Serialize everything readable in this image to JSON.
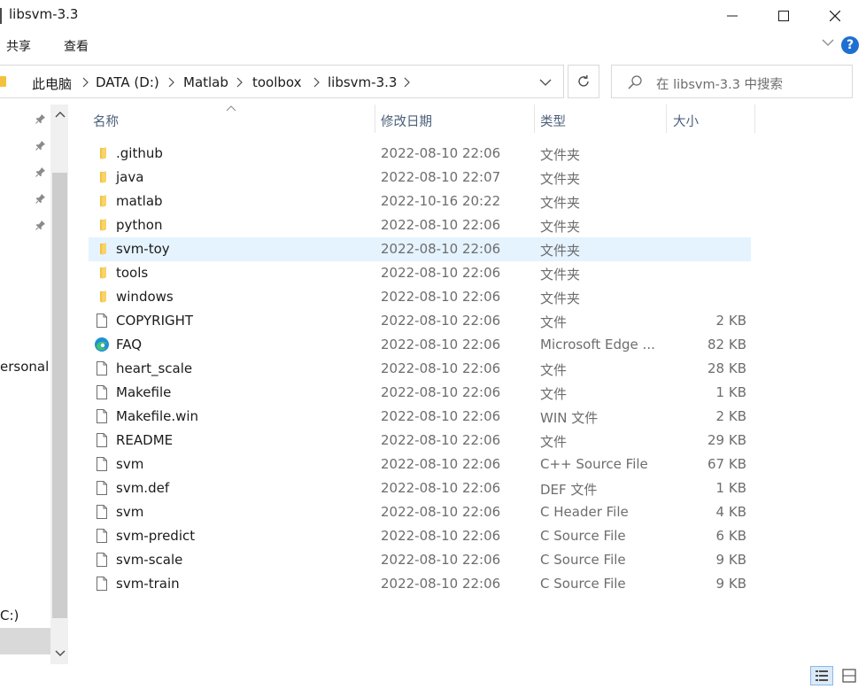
{
  "window": {
    "title": "libsvm-3.3",
    "controls": [
      "minimize-icon",
      "maximize-icon",
      "close-icon"
    ]
  },
  "ribbon": {
    "tabs": [
      "共享",
      "查看"
    ],
    "help_label": "?"
  },
  "address": {
    "breadcrumbs": [
      "此电脑",
      "DATA (D:)",
      "Matlab",
      "toolbox",
      "libsvm-3.3"
    ]
  },
  "search": {
    "placeholder": "在 libsvm-3.3 中搜索"
  },
  "nav": {
    "pinned_count": 5,
    "items": [
      "ersonal",
      "C:)"
    ]
  },
  "columns": {
    "name": "名称",
    "date": "修改日期",
    "type": "类型",
    "size": "大小"
  },
  "files": [
    {
      "name": ".github",
      "date": "2022-08-10 22:06",
      "type": "文件夹",
      "size": "",
      "icon": "folder-icon"
    },
    {
      "name": "java",
      "date": "2022-08-10 22:07",
      "type": "文件夹",
      "size": "",
      "icon": "folder-icon"
    },
    {
      "name": "matlab",
      "date": "2022-10-16 20:22",
      "type": "文件夹",
      "size": "",
      "icon": "folder-icon"
    },
    {
      "name": "python",
      "date": "2022-08-10 22:06",
      "type": "文件夹",
      "size": "",
      "icon": "folder-icon"
    },
    {
      "name": "svm-toy",
      "date": "2022-08-10 22:06",
      "type": "文件夹",
      "size": "",
      "icon": "folder-icon",
      "selected": true
    },
    {
      "name": "tools",
      "date": "2022-08-10 22:06",
      "type": "文件夹",
      "size": "",
      "icon": "folder-icon"
    },
    {
      "name": "windows",
      "date": "2022-08-10 22:06",
      "type": "文件夹",
      "size": "",
      "icon": "folder-icon"
    },
    {
      "name": "COPYRIGHT",
      "date": "2022-08-10 22:06",
      "type": "文件",
      "size": "2 KB",
      "icon": "file-icon"
    },
    {
      "name": "FAQ",
      "date": "2022-08-10 22:06",
      "type": "Microsoft Edge ...",
      "size": "82 KB",
      "icon": "edge-icon"
    },
    {
      "name": "heart_scale",
      "date": "2022-08-10 22:06",
      "type": "文件",
      "size": "28 KB",
      "icon": "file-icon"
    },
    {
      "name": "Makefile",
      "date": "2022-08-10 22:06",
      "type": "文件",
      "size": "1 KB",
      "icon": "file-icon"
    },
    {
      "name": "Makefile.win",
      "date": "2022-08-10 22:06",
      "type": "WIN 文件",
      "size": "2 KB",
      "icon": "file-icon"
    },
    {
      "name": "README",
      "date": "2022-08-10 22:06",
      "type": "文件",
      "size": "29 KB",
      "icon": "file-icon"
    },
    {
      "name": "svm",
      "date": "2022-08-10 22:06",
      "type": "C++ Source File",
      "size": "67 KB",
      "icon": "file-icon"
    },
    {
      "name": "svm.def",
      "date": "2022-08-10 22:06",
      "type": "DEF 文件",
      "size": "1 KB",
      "icon": "file-icon"
    },
    {
      "name": "svm",
      "date": "2022-08-10 22:06",
      "type": "C Header File",
      "size": "4 KB",
      "icon": "file-icon"
    },
    {
      "name": "svm-predict",
      "date": "2022-08-10 22:06",
      "type": "C Source File",
      "size": "6 KB",
      "icon": "file-icon"
    },
    {
      "name": "svm-scale",
      "date": "2022-08-10 22:06",
      "type": "C Source File",
      "size": "9 KB",
      "icon": "file-icon"
    },
    {
      "name": "svm-train",
      "date": "2022-08-10 22:06",
      "type": "C Source File",
      "size": "9 KB",
      "icon": "file-icon"
    }
  ],
  "colors": {
    "selection": "#e5f3ff",
    "folder": "#f3c23d",
    "header_text": "#4c607a",
    "secondary_text": "#6d6d6d",
    "help_blue": "#1e6fd0"
  }
}
